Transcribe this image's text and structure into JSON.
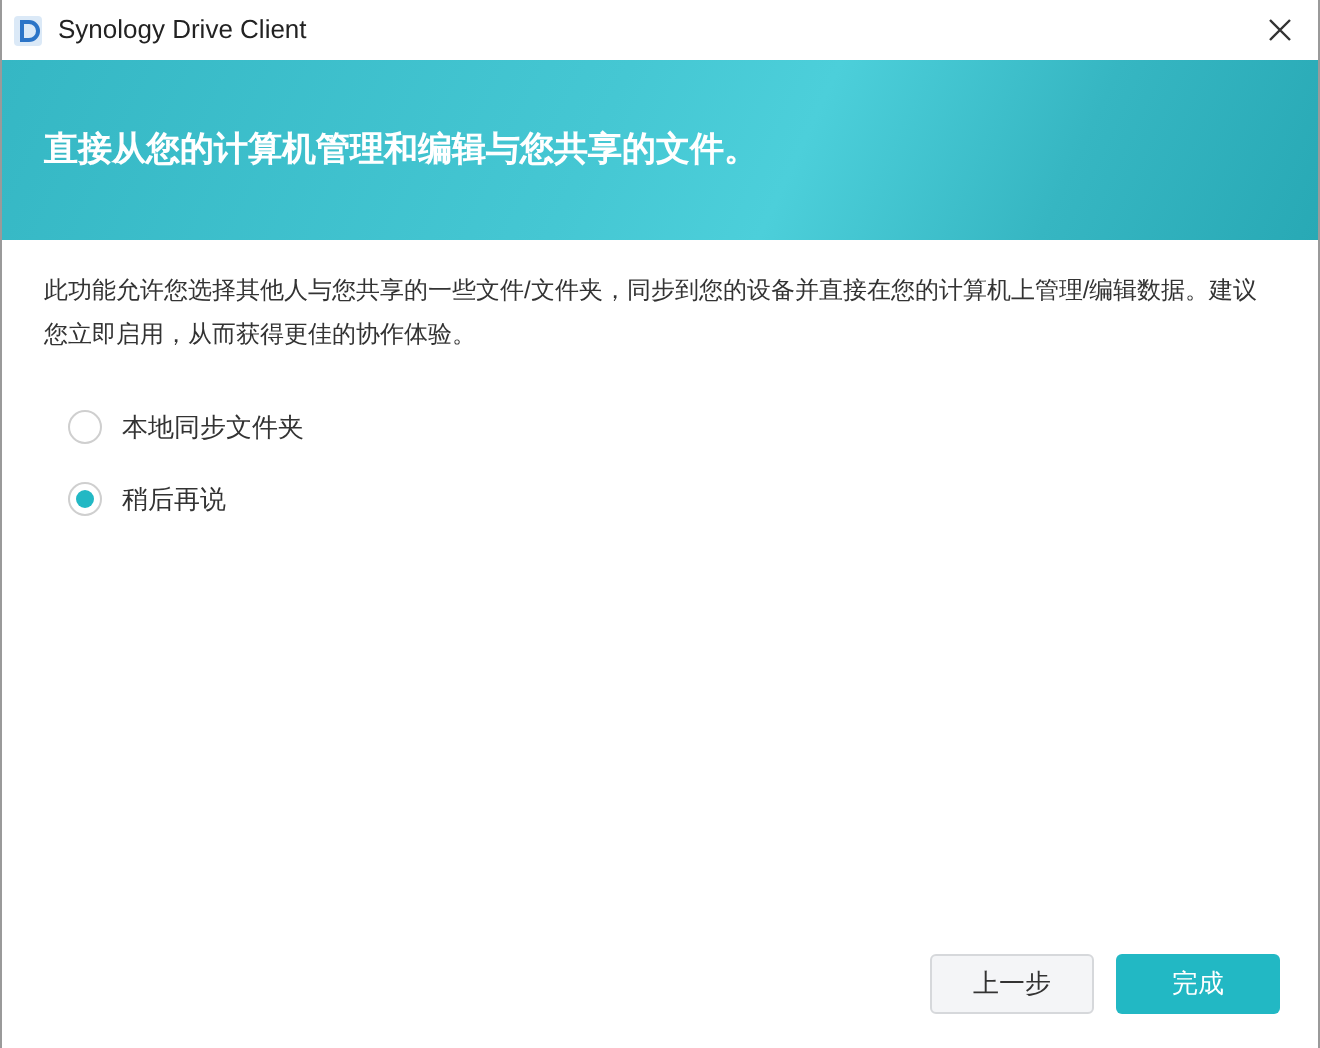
{
  "window": {
    "title": "Synology Drive Client"
  },
  "banner": {
    "heading": "直接从您的计算机管理和编辑与您共享的文件。"
  },
  "description": "此功能允许您选择其他人与您共享的一些文件/文件夹，同步到您的设备并直接在您的计算机上管理/编辑数据。建议您立即启用，从而获得更佳的协作体验。",
  "options": [
    {
      "label": "本地同步文件夹",
      "selected": false
    },
    {
      "label": "稍后再说",
      "selected": true
    }
  ],
  "buttons": [
    {
      "label": "上一步",
      "kind": "secondary"
    },
    {
      "label": "完成",
      "kind": "primary"
    }
  ]
}
